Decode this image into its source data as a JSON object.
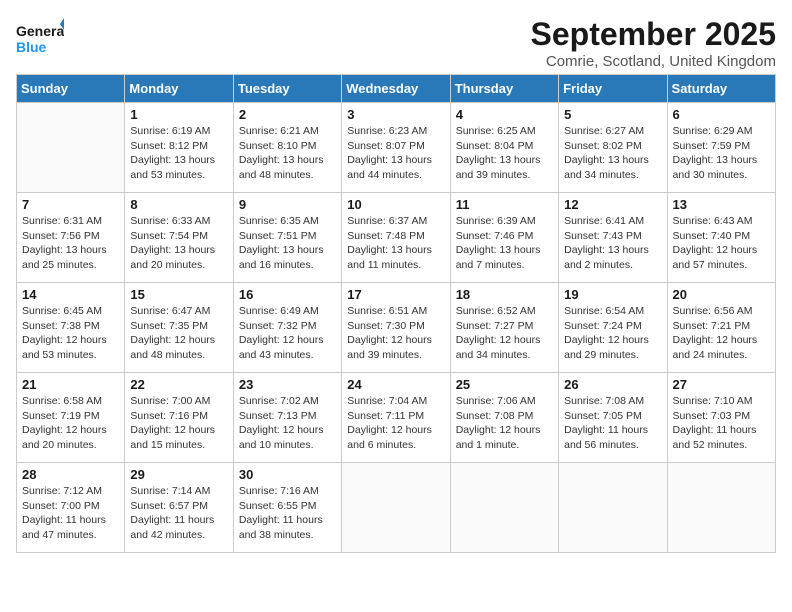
{
  "header": {
    "logo_line1": "General",
    "logo_line2": "Blue",
    "month_title": "September 2025",
    "location": "Comrie, Scotland, United Kingdom"
  },
  "days_of_week": [
    "Sunday",
    "Monday",
    "Tuesday",
    "Wednesday",
    "Thursday",
    "Friday",
    "Saturday"
  ],
  "weeks": [
    [
      {
        "day": "",
        "info": ""
      },
      {
        "day": "1",
        "info": "Sunrise: 6:19 AM\nSunset: 8:12 PM\nDaylight: 13 hours\nand 53 minutes."
      },
      {
        "day": "2",
        "info": "Sunrise: 6:21 AM\nSunset: 8:10 PM\nDaylight: 13 hours\nand 48 minutes."
      },
      {
        "day": "3",
        "info": "Sunrise: 6:23 AM\nSunset: 8:07 PM\nDaylight: 13 hours\nand 44 minutes."
      },
      {
        "day": "4",
        "info": "Sunrise: 6:25 AM\nSunset: 8:04 PM\nDaylight: 13 hours\nand 39 minutes."
      },
      {
        "day": "5",
        "info": "Sunrise: 6:27 AM\nSunset: 8:02 PM\nDaylight: 13 hours\nand 34 minutes."
      },
      {
        "day": "6",
        "info": "Sunrise: 6:29 AM\nSunset: 7:59 PM\nDaylight: 13 hours\nand 30 minutes."
      }
    ],
    [
      {
        "day": "7",
        "info": "Sunrise: 6:31 AM\nSunset: 7:56 PM\nDaylight: 13 hours\nand 25 minutes."
      },
      {
        "day": "8",
        "info": "Sunrise: 6:33 AM\nSunset: 7:54 PM\nDaylight: 13 hours\nand 20 minutes."
      },
      {
        "day": "9",
        "info": "Sunrise: 6:35 AM\nSunset: 7:51 PM\nDaylight: 13 hours\nand 16 minutes."
      },
      {
        "day": "10",
        "info": "Sunrise: 6:37 AM\nSunset: 7:48 PM\nDaylight: 13 hours\nand 11 minutes."
      },
      {
        "day": "11",
        "info": "Sunrise: 6:39 AM\nSunset: 7:46 PM\nDaylight: 13 hours\nand 7 minutes."
      },
      {
        "day": "12",
        "info": "Sunrise: 6:41 AM\nSunset: 7:43 PM\nDaylight: 13 hours\nand 2 minutes."
      },
      {
        "day": "13",
        "info": "Sunrise: 6:43 AM\nSunset: 7:40 PM\nDaylight: 12 hours\nand 57 minutes."
      }
    ],
    [
      {
        "day": "14",
        "info": "Sunrise: 6:45 AM\nSunset: 7:38 PM\nDaylight: 12 hours\nand 53 minutes."
      },
      {
        "day": "15",
        "info": "Sunrise: 6:47 AM\nSunset: 7:35 PM\nDaylight: 12 hours\nand 48 minutes."
      },
      {
        "day": "16",
        "info": "Sunrise: 6:49 AM\nSunset: 7:32 PM\nDaylight: 12 hours\nand 43 minutes."
      },
      {
        "day": "17",
        "info": "Sunrise: 6:51 AM\nSunset: 7:30 PM\nDaylight: 12 hours\nand 39 minutes."
      },
      {
        "day": "18",
        "info": "Sunrise: 6:52 AM\nSunset: 7:27 PM\nDaylight: 12 hours\nand 34 minutes."
      },
      {
        "day": "19",
        "info": "Sunrise: 6:54 AM\nSunset: 7:24 PM\nDaylight: 12 hours\nand 29 minutes."
      },
      {
        "day": "20",
        "info": "Sunrise: 6:56 AM\nSunset: 7:21 PM\nDaylight: 12 hours\nand 24 minutes."
      }
    ],
    [
      {
        "day": "21",
        "info": "Sunrise: 6:58 AM\nSunset: 7:19 PM\nDaylight: 12 hours\nand 20 minutes."
      },
      {
        "day": "22",
        "info": "Sunrise: 7:00 AM\nSunset: 7:16 PM\nDaylight: 12 hours\nand 15 minutes."
      },
      {
        "day": "23",
        "info": "Sunrise: 7:02 AM\nSunset: 7:13 PM\nDaylight: 12 hours\nand 10 minutes."
      },
      {
        "day": "24",
        "info": "Sunrise: 7:04 AM\nSunset: 7:11 PM\nDaylight: 12 hours\nand 6 minutes."
      },
      {
        "day": "25",
        "info": "Sunrise: 7:06 AM\nSunset: 7:08 PM\nDaylight: 12 hours\nand 1 minute."
      },
      {
        "day": "26",
        "info": "Sunrise: 7:08 AM\nSunset: 7:05 PM\nDaylight: 11 hours\nand 56 minutes."
      },
      {
        "day": "27",
        "info": "Sunrise: 7:10 AM\nSunset: 7:03 PM\nDaylight: 11 hours\nand 52 minutes."
      }
    ],
    [
      {
        "day": "28",
        "info": "Sunrise: 7:12 AM\nSunset: 7:00 PM\nDaylight: 11 hours\nand 47 minutes."
      },
      {
        "day": "29",
        "info": "Sunrise: 7:14 AM\nSunset: 6:57 PM\nDaylight: 11 hours\nand 42 minutes."
      },
      {
        "day": "30",
        "info": "Sunrise: 7:16 AM\nSunset: 6:55 PM\nDaylight: 11 hours\nand 38 minutes."
      },
      {
        "day": "",
        "info": ""
      },
      {
        "day": "",
        "info": ""
      },
      {
        "day": "",
        "info": ""
      },
      {
        "day": "",
        "info": ""
      }
    ]
  ]
}
